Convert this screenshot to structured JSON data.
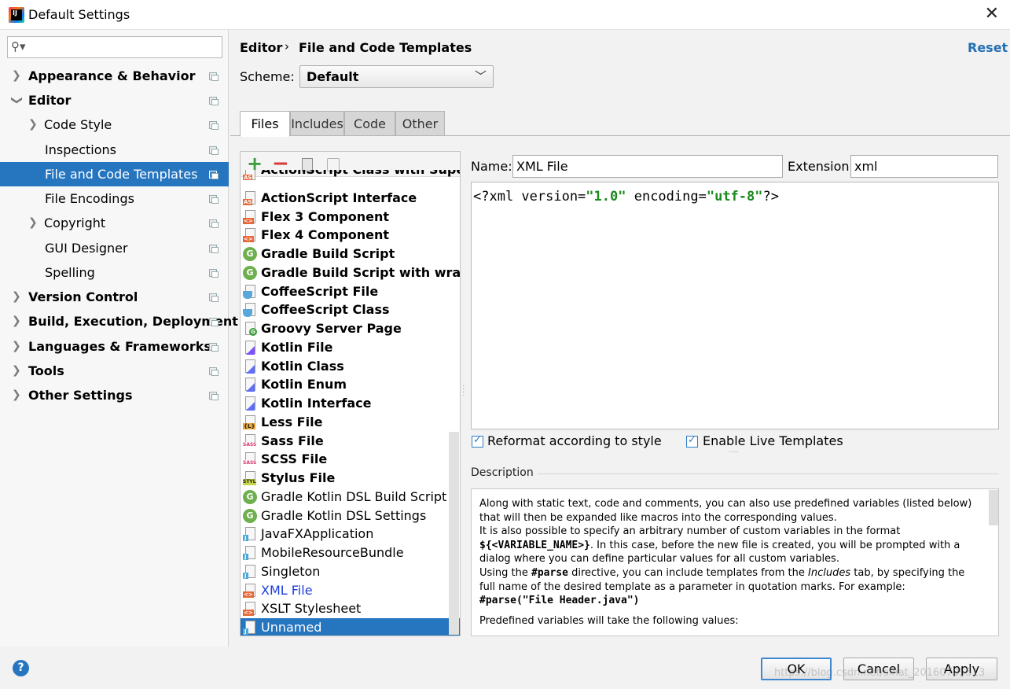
{
  "window": {
    "title": "Default Settings",
    "app_icon_letters": "IJ"
  },
  "search": {
    "placeholder": ""
  },
  "sidebar": {
    "items": [
      {
        "label": "Appearance & Behavior"
      },
      {
        "label": "Editor"
      },
      {
        "label": "Code Style"
      },
      {
        "label": "Inspections"
      },
      {
        "label": "File and Code Templates"
      },
      {
        "label": "File Encodings"
      },
      {
        "label": "Copyright"
      },
      {
        "label": "GUI Designer"
      },
      {
        "label": "Spelling"
      },
      {
        "label": "Version Control"
      },
      {
        "label": "Build, Execution, Deployment"
      },
      {
        "label": "Languages & Frameworks"
      },
      {
        "label": "Tools"
      },
      {
        "label": "Other Settings"
      }
    ]
  },
  "breadcrumb": {
    "parent": "Editor",
    "separator": "›",
    "current": "File and Code Templates"
  },
  "header": {
    "reset_label": "Reset"
  },
  "scheme": {
    "label": "Scheme:",
    "value": "Default"
  },
  "tabs": [
    {
      "label": "Files"
    },
    {
      "label": "Includes"
    },
    {
      "label": "Code"
    },
    {
      "label": "Other"
    }
  ],
  "templates": {
    "items": [
      {
        "name": "ActionScript Class with Supers"
      },
      {
        "name": "ActionScript Interface"
      },
      {
        "name": "Flex 3 Component"
      },
      {
        "name": "Flex 4 Component"
      },
      {
        "name": "Gradle Build Script"
      },
      {
        "name": "Gradle Build Script with wrapper"
      },
      {
        "name": "CoffeeScript File"
      },
      {
        "name": "CoffeeScript Class"
      },
      {
        "name": "Groovy Server Page"
      },
      {
        "name": "Kotlin File"
      },
      {
        "name": "Kotlin Class"
      },
      {
        "name": "Kotlin Enum"
      },
      {
        "name": "Kotlin Interface"
      },
      {
        "name": "Less File"
      },
      {
        "name": "Sass File"
      },
      {
        "name": "SCSS File"
      },
      {
        "name": "Stylus File"
      },
      {
        "name": "Gradle Kotlin DSL Build Script"
      },
      {
        "name": "Gradle Kotlin DSL Settings"
      },
      {
        "name": "JavaFXApplication"
      },
      {
        "name": "MobileResourceBundle"
      },
      {
        "name": "Singleton"
      },
      {
        "name": "XML File"
      },
      {
        "name": "XSLT Stylesheet"
      },
      {
        "name": "Unnamed"
      }
    ],
    "icon_glyphs": {
      "gradle": "G"
    }
  },
  "form": {
    "name_label": "Name:",
    "name_value": "XML File",
    "extension_label": "Extension:",
    "extension_value": "xml"
  },
  "editor": {
    "code_prefix": "<?xml version=",
    "code_str1": "\"1.0\"",
    "code_mid": " encoding=",
    "code_str2": "\"utf-8\"",
    "code_suffix": "?>"
  },
  "options": {
    "reformat_label": "Reformat according to style",
    "live_templates_label": "Enable Live Templates"
  },
  "description": {
    "title": "Description",
    "line1": "Along with static text, code and comments, you can also use predefined variables (listed below) that will then be expanded like macros into the corresponding values.",
    "line2": "It is also possible to specify an arbitrary number of custom variables in the format",
    "var_format": "${<VARIABLE_NAME>}",
    "line3": ". In this case, before the new file is created, you will be prompted with a dialog where you can define particular values for all custom variables.",
    "line4a": "Using the ",
    "parse_kw": "#parse",
    "line4b": " directive, you can include templates from the ",
    "includes_word": "Includes",
    "line4c": " tab, by specifying the full name of the desired template as a parameter in quotation marks. For example:",
    "example": "#parse(\"File Header.java\")",
    "line5": "Predefined variables will take the following values:"
  },
  "footer": {
    "help_label": "?",
    "ok_label": "OK",
    "cancel_label": "Cancel",
    "apply_label": "Apply",
    "watermark": "https://blog.csdn.net/sinat_20160705513"
  },
  "colors": {
    "accent": "#2675bf",
    "link": "#2470b3",
    "string": "#1c8a1c",
    "highlight_text": "#1b3ddc"
  }
}
